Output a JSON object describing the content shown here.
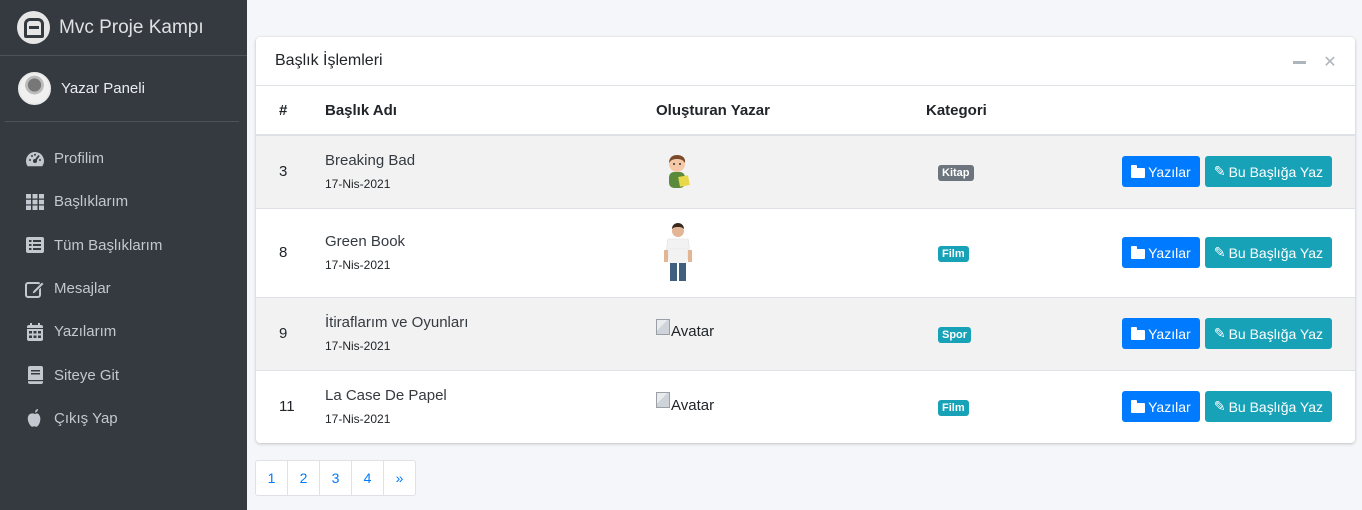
{
  "brand": {
    "title": "Mvc Proje Kampı"
  },
  "user": {
    "name": "Yazar Paneli"
  },
  "sidebar": {
    "items": [
      {
        "label": "Profilim",
        "icon": "tachometer-icon"
      },
      {
        "label": "Başlıklarım",
        "icon": "grid-icon"
      },
      {
        "label": "Tüm Başlıklarım",
        "icon": "list-icon"
      },
      {
        "label": "Mesajlar",
        "icon": "edit-icon"
      },
      {
        "label": "Yazılarım",
        "icon": "calendar-icon"
      },
      {
        "label": "Siteye Git",
        "icon": "book-icon"
      },
      {
        "label": "Çıkış Yap",
        "icon": "apple-icon"
      }
    ]
  },
  "card": {
    "title": "Başlık İşlemleri",
    "columns": [
      "#",
      "Başlık Adı",
      "Oluşturan Yazar",
      "Kategori",
      ""
    ],
    "rows": [
      {
        "id": "3",
        "title": "Breaking Bad",
        "date": "17-Nis-2021",
        "author_image": "avatar-cartoon",
        "category": "Kitap",
        "btn_yazilar": "Yazılar",
        "btn_yaz": "Bu Başlığa Yaz"
      },
      {
        "id": "8",
        "title": "Green Book",
        "date": "17-Nis-2021",
        "author_image": "avatar-man",
        "category": "Film",
        "btn_yazilar": "Yazılar",
        "btn_yaz": "Bu Başlığa Yaz"
      },
      {
        "id": "9",
        "title": "İtiraflarım ve Oyunları",
        "date": "17-Nis-2021",
        "author_alt": "Avatar",
        "category": "Spor",
        "btn_yazilar": "Yazılar",
        "btn_yaz": "Bu Başlığa Yaz"
      },
      {
        "id": "11",
        "title": "La Case De Papel",
        "date": "17-Nis-2021",
        "author_alt": "Avatar",
        "category": "Film",
        "btn_yazilar": "Yazılar",
        "btn_yaz": "Bu Başlığa Yaz"
      }
    ]
  },
  "pagination": {
    "pages": [
      "1",
      "2",
      "3",
      "4",
      "»"
    ]
  },
  "colors": {
    "sidebar": "#343a40",
    "primary": "#007bff",
    "info": "#17a2b8",
    "secondary": "#6c757d"
  }
}
